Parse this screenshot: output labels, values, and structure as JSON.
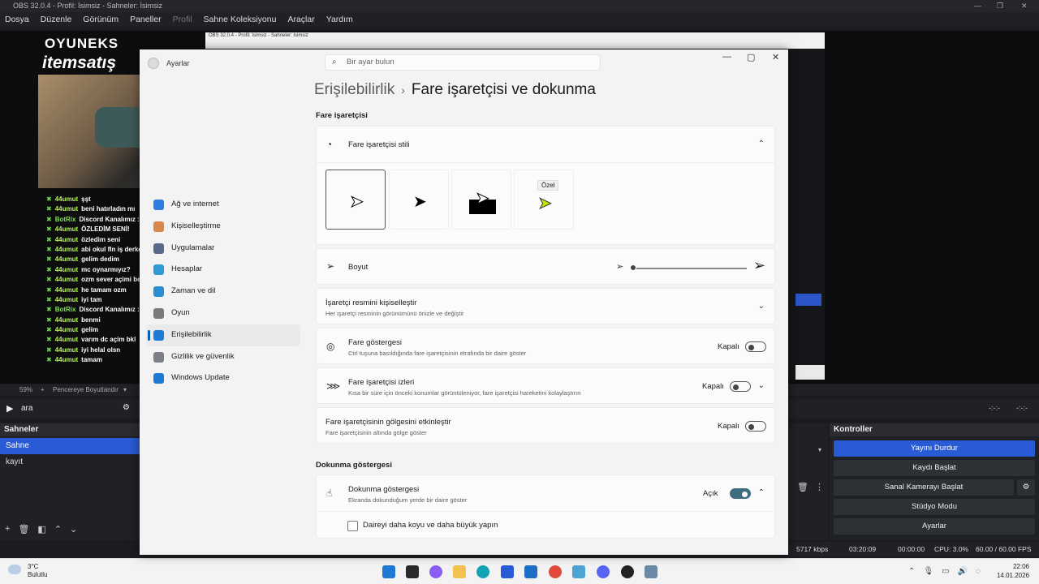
{
  "obs": {
    "title": "OBS 32.0.4 - Profil: İsimsiz - Sahneler: İsimsiz",
    "menu": [
      "Dosya",
      "Düzenle",
      "Görünüm",
      "Paneller",
      "Profil",
      "Sahne Koleksiyonu",
      "Araçlar",
      "Yardım"
    ],
    "logo_top": "OYUNEKS",
    "logo_bottom": "itemsatış",
    "chat": [
      {
        "user": "44umut",
        "msg": "şşt"
      },
      {
        "user": "44umut",
        "msg": "beni hatırladın mı"
      },
      {
        "user": "BotRix",
        "msg": "Discord Kanalımız :"
      },
      {
        "user": "44umut",
        "msg": "ÖZLEDİM SENİ!"
      },
      {
        "user": "44umut",
        "msg": "özledim seni"
      },
      {
        "user": "44umut",
        "msg": "abi okul fln iş derken"
      },
      {
        "user": "44umut",
        "msg": "gelim dedim"
      },
      {
        "user": "44umut",
        "msg": "mc oynarmıyız?"
      },
      {
        "user": "44umut",
        "msg": "ozm sever açimi ben"
      },
      {
        "user": "44umut",
        "msg": "he tamam ozm"
      },
      {
        "user": "44umut",
        "msg": "iyi tam"
      },
      {
        "user": "BotRix",
        "msg": "Discord Kanalımız :"
      },
      {
        "user": "44umut",
        "msg": "benmi"
      },
      {
        "user": "44umut",
        "msg": "gelim"
      },
      {
        "user": "44umut",
        "msg": "varım dc açim bkl"
      },
      {
        "user": "44umut",
        "msg": "iyi helal olsn"
      },
      {
        "user": "44umut",
        "msg": "tamam"
      }
    ],
    "zoom": "59%",
    "resize_label": "Pencereye Boyutlandır",
    "play_label": "ara",
    "time_left": "-:-:-",
    "time_right": "-:-:-",
    "scenes_title": "Sahneler",
    "scenes": [
      "Sahne",
      "kayıt"
    ],
    "controls_title": "Kontroller",
    "controls": [
      "Yayını Durdur",
      "Kaydı Başlat",
      "Sanal Kamerayı Başlat",
      "Stüdyo Modu",
      "Ayarlar"
    ],
    "status": {
      "bitrate": "5717 kbps",
      "stream_time": "03:20:09",
      "rec_time": "00:00:00",
      "cpu": "CPU: 3.0%",
      "fps": "60.00 / 60.00 FPS"
    }
  },
  "taskbar": {
    "temp": "3°C",
    "weather": "Bulutlu",
    "time": "22:06",
    "date": "14.01.2026"
  },
  "settings": {
    "app_title": "Ayarlar",
    "search_placeholder": "Bir ayar bulun",
    "breadcrumb_parent": "Erişilebilirlik",
    "breadcrumb_sep": "›",
    "breadcrumb_current": "Fare işaretçisi ve dokunma",
    "nav": [
      {
        "label": "Ağ ve internet",
        "icon": "wifi-icon",
        "color": "#2f7de1"
      },
      {
        "label": "Kişiselleştirme",
        "icon": "brush-icon",
        "color": "#d9884a"
      },
      {
        "label": "Uygulamalar",
        "icon": "apps-icon",
        "color": "#5a6a8a"
      },
      {
        "label": "Hesaplar",
        "icon": "person-icon",
        "color": "#2e9bd6"
      },
      {
        "label": "Zaman ve dil",
        "icon": "globe-clock-icon",
        "color": "#2a8fd1"
      },
      {
        "label": "Oyun",
        "icon": "gamepad-icon",
        "color": "#7a7a7a"
      },
      {
        "label": "Erişilebilirlik",
        "icon": "accessibility-icon",
        "color": "#1f7ad6"
      },
      {
        "label": "Gizlilik ve güvenlik",
        "icon": "shield-icon",
        "color": "#7c7f86"
      },
      {
        "label": "Windows Update",
        "icon": "update-icon",
        "color": "#1f7ad6"
      }
    ],
    "section_pointer": "Fare işaretçisi",
    "pointer_style": "Fare işaretçisi stili",
    "custom_label": "Özel",
    "size_label": "Boyut",
    "size_value": 0.0,
    "customize_title": "İşaretçi resmini kişiselleştir",
    "customize_sub": "Her işaretçi resminin görünümünü önizle ve değiştir",
    "indicator_title": "Fare göstergesi",
    "indicator_sub": "Ctrl tuşuna basıldığında fare işaretçisinin etrafında bir daire göster",
    "indicator_state": "Kapalı",
    "trails_title": "Fare işaretçisi izleri",
    "trails_sub": "Kısa bir süre için önceki konumlar görüntüleniyor, fare işaretçisi hareketini kolaylaştırın",
    "trails_state": "Kapalı",
    "shadow_title": "Fare işaretçisinin gölgesini etkinleştir",
    "shadow_sub": "Fare işaretçisinin altında gölge göster",
    "shadow_state": "Kapalı",
    "section_touch": "Dokunma göstergesi",
    "touch_title": "Dokunma göstergesi",
    "touch_sub": "Ekranda dokunduğum yerde bir daire göster",
    "touch_state": "Açık",
    "touch_option": "Daireyi daha koyu ve daha büyük yapın"
  }
}
